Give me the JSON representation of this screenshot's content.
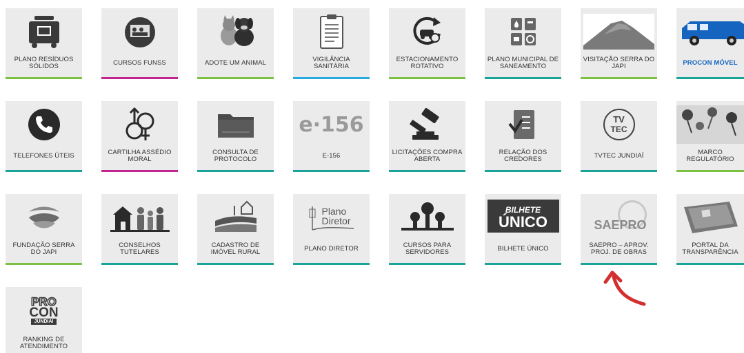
{
  "tiles": [
    {
      "label": "PLANO RESÍDUOS SÓLIDOS",
      "icon": "trash-container-icon"
    },
    {
      "label": "CURSOS FUNSS",
      "icon": "classroom-icon"
    },
    {
      "label": "ADOTE UM ANIMAL",
      "icon": "pets-icon"
    },
    {
      "label": "VIGILÂNCIA SANITÁRIA",
      "icon": "clipboard-icon"
    },
    {
      "label": "ESTACIONAMENTO ROTATIVO",
      "icon": "parking-car-icon"
    },
    {
      "label": "PLANO MUNICIPAL DE SANEAMENTO",
      "icon": "sanitation-icon"
    },
    {
      "label": "VISITAÇÃO SERRA DO JAPI",
      "icon": "mountain-icon"
    },
    {
      "label": "PROCON MÓVEL",
      "icon": "van-icon"
    },
    {
      "label": "TELEFONES ÚTEIS",
      "icon": "phone-icon"
    },
    {
      "label": "CARTILHA ASSÉDIO MORAL",
      "icon": "gender-symbols-icon"
    },
    {
      "label": "CONSULTA DE PROTOCOLO",
      "icon": "folder-icon"
    },
    {
      "label": "E-156",
      "icon": "e156-logo-icon",
      "logo_text": "e·156"
    },
    {
      "label": "LICITAÇÕES COMPRA ABERTA",
      "icon": "gavel-icon"
    },
    {
      "label": "RELAÇÃO DOS CREDORES",
      "icon": "checklist-icon"
    },
    {
      "label": "TVTEC JUNDIAÍ",
      "icon": "tvtec-logo-icon",
      "logo_text_1": "TV",
      "logo_text_2": "TEC"
    },
    {
      "label": "MARCO REGULATÓRIO",
      "icon": "pushpins-icon"
    },
    {
      "label": "FUNDAÇÃO SERRA DO JAPI",
      "icon": "serra-logo-icon"
    },
    {
      "label": "CONSELHOS TUTELARES",
      "icon": "family-house-icon"
    },
    {
      "label": "CADASTRO DE IMÓVEL RURAL",
      "icon": "rural-landscape-icon"
    },
    {
      "label": "PLANO DIRETOR",
      "icon": "plano-diretor-logo-icon",
      "logo_text_1": "Plano",
      "logo_text_2": "Diretor"
    },
    {
      "label": "CURSOS PARA SERVIDORES",
      "icon": "trees-icon"
    },
    {
      "label": "BILHETE ÚNICO",
      "icon": "bilhete-unico-logo-icon",
      "logo_text_1": "BILHETE",
      "logo_text_2": "ÚNICO"
    },
    {
      "label": "SAEPRO – APROV. PROJ. DE OBRAS",
      "icon": "saepro-logo-icon",
      "logo_text": "SAEPRO"
    },
    {
      "label": "PORTAL DA TRANSPARÊNCIA",
      "icon": "transparency-card-icon"
    },
    {
      "label": "RANKING DE ATENDIMENTO",
      "icon": "procon-logo-icon",
      "logo_text_1": "PRO",
      "logo_text_2": "CON",
      "logo_text_3": "JUNDIAÍ"
    }
  ],
  "colors": {
    "tile_bg": "#ebebeb",
    "green": "#7cc242",
    "magenta": "#c2258f",
    "blue": "#29abe2",
    "teal": "#1aa398",
    "icon_dark": "#3a3a3a",
    "procon_blue": "#1565c0",
    "arrow_red": "#d32f2f"
  },
  "annotation": {
    "icon": "red-curved-arrow-icon"
  }
}
